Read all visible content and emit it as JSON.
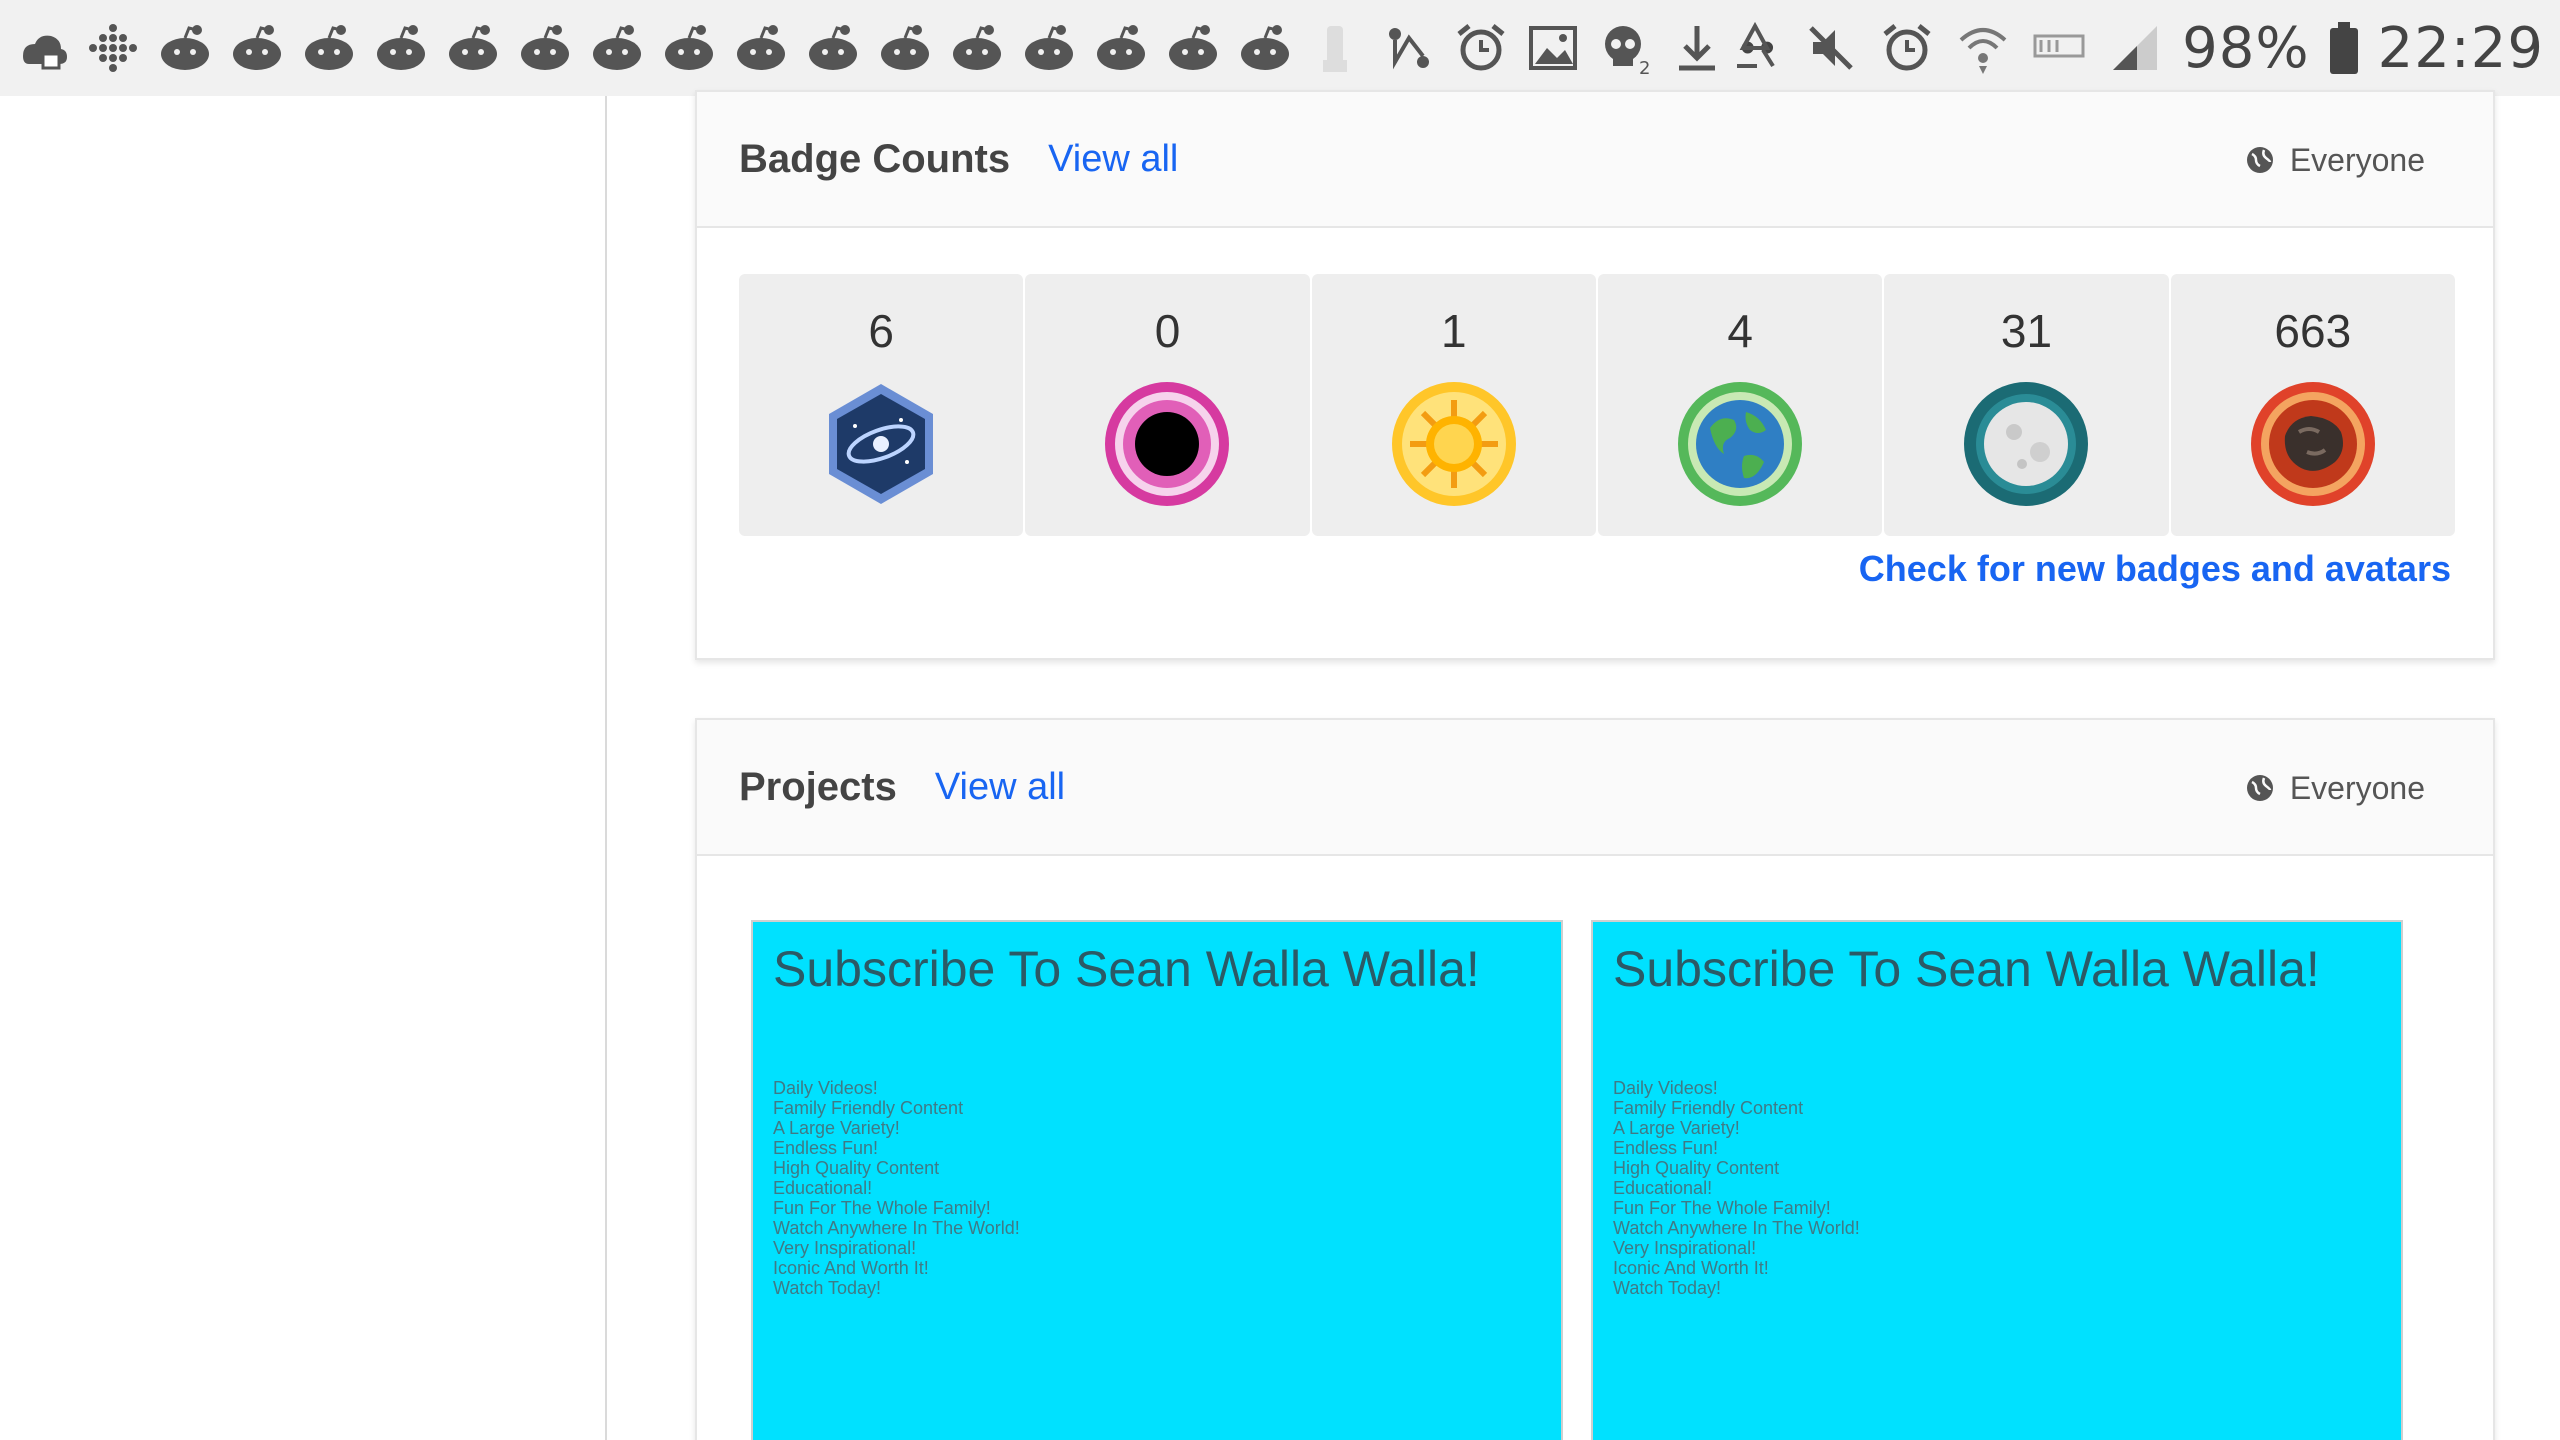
{
  "status_bar": {
    "notification_icons": [
      "cloud-icon",
      "dots-grid-icon",
      "reddit-icon",
      "reddit-icon",
      "reddit-icon",
      "reddit-icon",
      "reddit-icon",
      "reddit-icon",
      "reddit-icon",
      "reddit-icon",
      "reddit-icon",
      "reddit-icon",
      "reddit-icon",
      "reddit-icon",
      "reddit-icon",
      "reddit-icon",
      "reddit-icon",
      "reddit-icon"
    ],
    "battery": "98%",
    "time": "22:29",
    "more_indicator": "••"
  },
  "badge_section": {
    "title": "Badge Counts",
    "view_all": "View all",
    "visibility": "Everyone",
    "badges": [
      {
        "count": "6",
        "icon": "galaxy-badge-icon",
        "color": "#3b6bb5"
      },
      {
        "count": "0",
        "icon": "black-hole-badge-icon",
        "color": "#d63aa0"
      },
      {
        "count": "1",
        "icon": "sun-badge-icon",
        "color": "#f5b800"
      },
      {
        "count": "4",
        "icon": "earth-badge-icon",
        "color": "#3aa64a"
      },
      {
        "count": "31",
        "icon": "moon-badge-icon",
        "color": "#1b6b74"
      },
      {
        "count": "663",
        "icon": "meteorite-badge-icon",
        "color": "#e0422a"
      }
    ],
    "check_link": "Check for new badges and avatars"
  },
  "projects_section": {
    "title": "Projects",
    "view_all": "View all",
    "visibility": "Everyone",
    "projects": [
      {
        "title": "Subscribe To Sean Walla Walla!",
        "lines": [
          "Daily Videos!",
          "Family Friendly Content",
          "A Large Variety!",
          "Endless Fun!",
          "High Quality Content",
          "Educational!",
          "Fun For The Whole Family!",
          "Watch Anywhere In The World!",
          "Very Inspirational!",
          "Iconic And Worth It!",
          "Watch Today!"
        ]
      },
      {
        "title": "Subscribe To Sean Walla Walla!",
        "lines": [
          "Daily Videos!",
          "Family Friendly Content",
          "A Large Variety!",
          "Endless Fun!",
          "High Quality Content",
          "Educational!",
          "Fun For The Whole Family!",
          "Watch Anywhere In The World!",
          "Very Inspirational!",
          "Iconic And Worth It!",
          "Watch Today!"
        ]
      }
    ]
  },
  "colors": {
    "link": "#1865f2",
    "thumb_bg": "#00e1ff",
    "status_bar_bg": "#f1f1f1"
  }
}
